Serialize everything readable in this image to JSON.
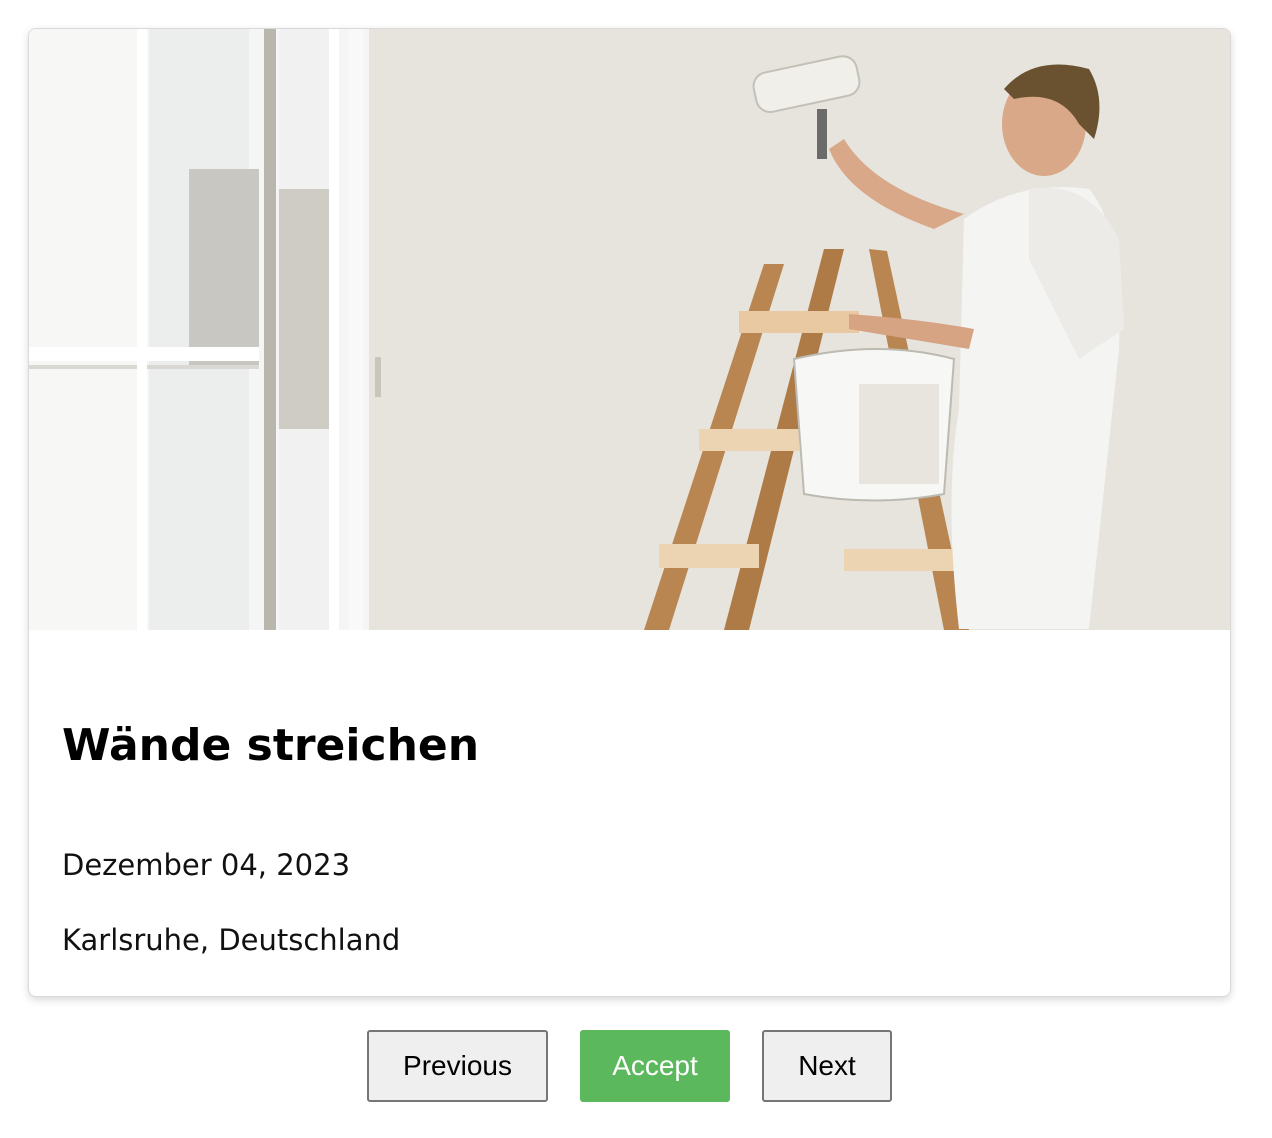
{
  "card": {
    "title": "Wände streichen",
    "date": "Dezember 04, 2023",
    "location": "Karlsruhe, Deutschland",
    "image": "painter-on-ladder-photo"
  },
  "actions": {
    "previous_label": "Previous",
    "accept_label": "Accept",
    "next_label": "Next"
  },
  "colors": {
    "accept": "#5cb85c",
    "secondary_button": "#efefef",
    "text": "#000000"
  }
}
